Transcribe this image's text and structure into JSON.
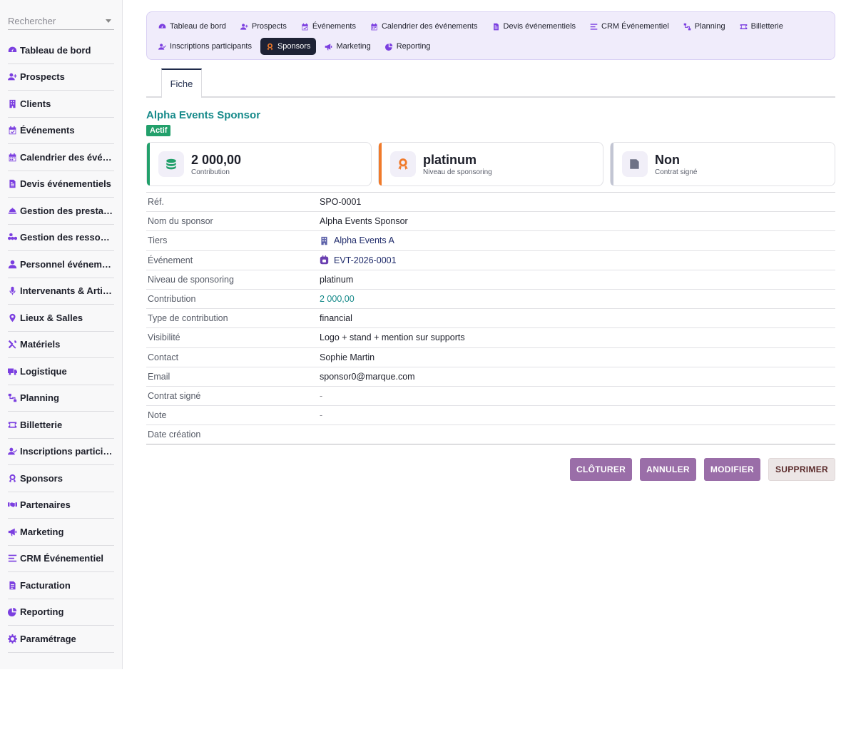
{
  "search": {
    "placeholder": "Rechercher"
  },
  "sidebar": {
    "items": [
      {
        "label": "Tableau de bord",
        "icon": "gauge-icon"
      },
      {
        "label": "Prospects",
        "icon": "user-plus-icon"
      },
      {
        "label": "Clients",
        "icon": "building-icon"
      },
      {
        "label": "Événements",
        "icon": "calendar-check-icon"
      },
      {
        "label": "Calendrier des événements",
        "icon": "calendar-icon"
      },
      {
        "label": "Devis événementiels",
        "icon": "file-invoice-icon"
      },
      {
        "label": "Gestion des prestations",
        "icon": "service-bell-icon"
      },
      {
        "label": "Gestion des ressources",
        "icon": "cubes-icon"
      },
      {
        "label": "Personnel événementiel",
        "icon": "user-icon"
      },
      {
        "label": "Intervenants & Artistes",
        "icon": "microphone-icon"
      },
      {
        "label": "Lieux & Salles",
        "icon": "map-pin-icon"
      },
      {
        "label": "Matériels",
        "icon": "tools-icon"
      },
      {
        "label": "Logistique",
        "icon": "truck-icon"
      },
      {
        "label": "Planning",
        "icon": "sitemap-icon"
      },
      {
        "label": "Billetterie",
        "icon": "ticket-icon"
      },
      {
        "label": "Inscriptions participants",
        "icon": "user-check-icon"
      },
      {
        "label": "Sponsors",
        "icon": "award-icon"
      },
      {
        "label": "Partenaires",
        "icon": "handshake-icon"
      },
      {
        "label": "Marketing",
        "icon": "megaphone-icon"
      },
      {
        "label": "CRM Événementiel",
        "icon": "list-icon"
      },
      {
        "label": "Facturation",
        "icon": "file-text-icon"
      },
      {
        "label": "Reporting",
        "icon": "pie-chart-icon"
      },
      {
        "label": "Paramétrage",
        "icon": "gear-icon"
      }
    ]
  },
  "topnav": {
    "items": [
      {
        "label": "Tableau de bord",
        "icon": "gauge-icon"
      },
      {
        "label": "Prospects",
        "icon": "user-plus-icon"
      },
      {
        "label": "Événements",
        "icon": "calendar-check-icon"
      },
      {
        "label": "Calendrier des événements",
        "icon": "calendar-icon"
      },
      {
        "label": "Devis événementiels",
        "icon": "file-invoice-icon"
      },
      {
        "label": "CRM Événementiel",
        "icon": "list-icon"
      },
      {
        "label": "Planning",
        "icon": "sitemap-icon"
      },
      {
        "label": "Billetterie",
        "icon": "ticket-icon"
      },
      {
        "label": "Inscriptions participants",
        "icon": "user-check-icon"
      },
      {
        "label": "Sponsors",
        "icon": "award-icon",
        "active": true
      },
      {
        "label": "Marketing",
        "icon": "megaphone-icon"
      },
      {
        "label": "Reporting",
        "icon": "pie-chart-icon"
      }
    ]
  },
  "tabs": {
    "fiche": "Fiche"
  },
  "record": {
    "title": "Alpha Events Sponsor",
    "status": "Actif"
  },
  "cards": [
    {
      "value": "2 000,00",
      "label": "Contribution",
      "icon": "coins-icon",
      "accent": "#22a06b"
    },
    {
      "value": "platinum",
      "label": "Niveau de sponsoring",
      "icon": "award-icon",
      "accent": "#f07a2a"
    },
    {
      "value": "Non",
      "label": "Contrat signé",
      "icon": "signature-icon",
      "accent": "#c2c5d3"
    }
  ],
  "details": [
    {
      "key": "Réf.",
      "value": "SPO-0001"
    },
    {
      "key": "Nom du sponsor",
      "value": "Alpha Events Sponsor"
    },
    {
      "key": "Tiers",
      "value": "Alpha Events A",
      "icon": "building-icon",
      "style": "link"
    },
    {
      "key": "Événement",
      "value": "EVT-2026-0001",
      "icon": "event-icon",
      "style": "link"
    },
    {
      "key": "Niveau de sponsoring",
      "value": "platinum"
    },
    {
      "key": "Contribution",
      "value": "2 000,00",
      "style": "teal"
    },
    {
      "key": "Type de contribution",
      "value": "financial"
    },
    {
      "key": "Visibilité",
      "value": "Logo + stand + mention sur supports"
    },
    {
      "key": "Contact",
      "value": "Sophie Martin"
    },
    {
      "key": "Email",
      "value": "sponsor0@marque.com"
    },
    {
      "key": "Contrat signé",
      "value": "-",
      "style": "muted"
    },
    {
      "key": "Note",
      "value": "-",
      "style": "muted"
    },
    {
      "key": "Date création",
      "value": ""
    }
  ],
  "actions": {
    "close": "CLÔTURER",
    "cancel": "ANNULER",
    "edit": "MODIFIER",
    "delete": "SUPPRIMER"
  },
  "colors": {
    "accent": "#7b3fe0",
    "title": "#168a8a",
    "active_nav": "#1e2235",
    "button": "#9a6ea8"
  }
}
